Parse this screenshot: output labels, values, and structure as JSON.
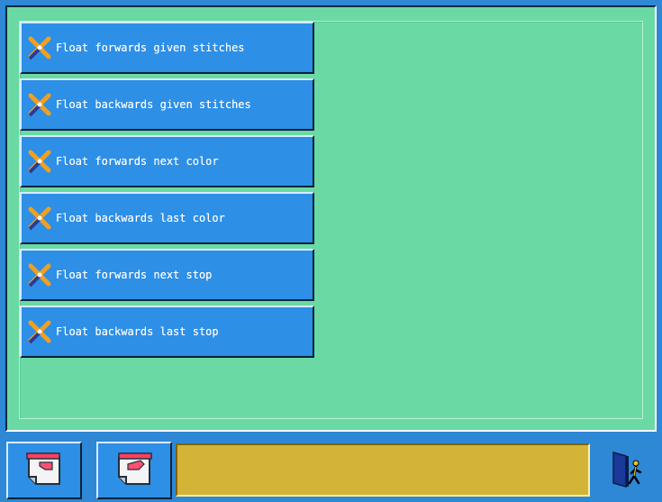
{
  "menu": {
    "items": [
      {
        "label": "Float forwards given stitches",
        "icon": "needle-cross-icon"
      },
      {
        "label": "Float backwards given stitches",
        "icon": "needle-cross-icon"
      },
      {
        "label": "Float forwards next color",
        "icon": "needle-cross-icon"
      },
      {
        "label": "Float backwards last color",
        "icon": "needle-cross-icon"
      },
      {
        "label": "Float forwards next stop",
        "icon": "needle-cross-icon"
      },
      {
        "label": "Float backwards last stop",
        "icon": "needle-cross-icon"
      }
    ]
  },
  "footer": {
    "left_buttons": [
      {
        "icon": "page-back-icon"
      },
      {
        "icon": "page-forward-icon"
      }
    ],
    "status_text": "",
    "exit_icon": "exit-door-icon"
  },
  "colors": {
    "background": "#2e88d6",
    "panel": "#6ad9a4",
    "button": "#2e8fe6",
    "status_bar": "#d4b436"
  }
}
